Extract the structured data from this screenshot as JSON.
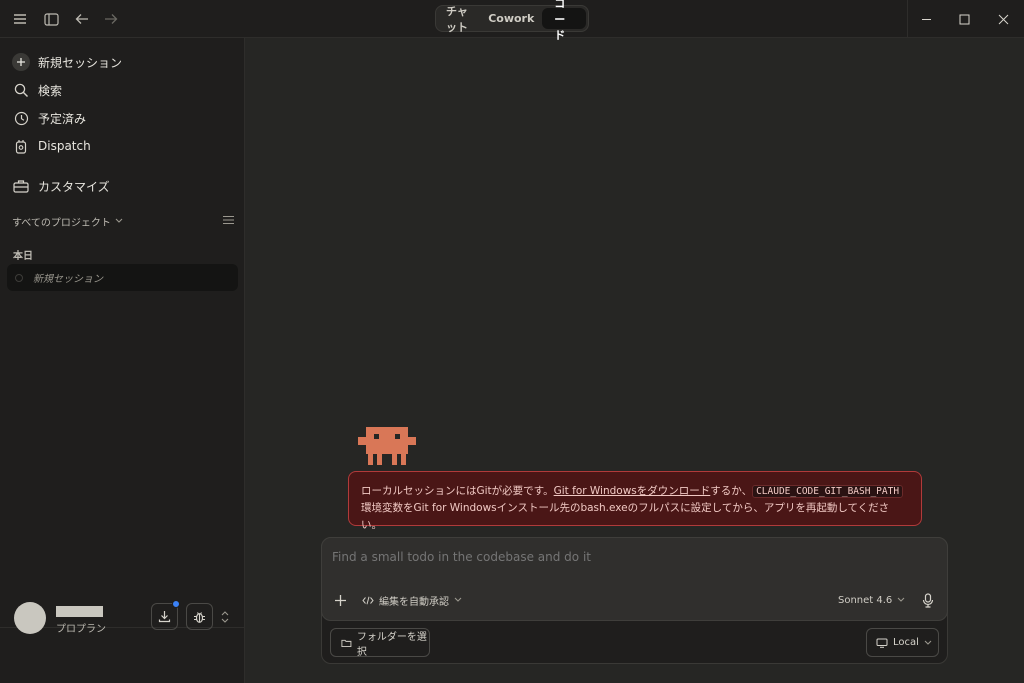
{
  "titlebar": {
    "tabs": [
      {
        "label": "チャット",
        "active": false
      },
      {
        "label": "Cowork",
        "active": false
      },
      {
        "label": "コード",
        "active": true
      }
    ]
  },
  "sidebar": {
    "nav": [
      {
        "label": "新規セッション",
        "icon": "plus-icon"
      },
      {
        "label": "検索",
        "icon": "search-icon"
      },
      {
        "label": "予定済み",
        "icon": "clock-icon"
      },
      {
        "label": "Dispatch",
        "icon": "device-icon"
      },
      {
        "label": "カスタマイズ",
        "icon": "toolbox-icon"
      }
    ],
    "projects_label": "すべてのプロジェクト",
    "section_today": "本日",
    "sessions": [
      {
        "label": "新規セッション"
      }
    ],
    "user": {
      "plan": "プロプラン"
    }
  },
  "main": {
    "error": {
      "text_1": "ローカルセッションにはGitが必要です。",
      "link": "Git for Windowsをダウンロード",
      "text_2": "するか、",
      "code": "CLAUDE_CODE_GIT_BASH_PATH",
      "text_3": "環境変数をGit for Windowsインストール先のbash.exeのフルパスに設定してから、アプリを再起動してください。"
    },
    "composer": {
      "placeholder": "Find a small todo in the codebase and do it",
      "mode_label": "編集を自動承認",
      "model_label": "Sonnet 4.6",
      "folder_label": "フォルダーを選択",
      "env_label": "Local"
    }
  },
  "colors": {
    "background": "#262624",
    "sidebar": "#1f1e1d",
    "error_bg": "#4a1616",
    "error_border": "#b13a3a",
    "mascot": "#d97757",
    "notification": "#3b82f6"
  }
}
